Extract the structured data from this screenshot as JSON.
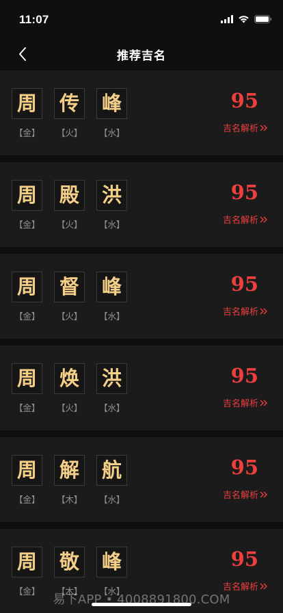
{
  "status_bar": {
    "time": "11:07"
  },
  "nav": {
    "title": "推荐吉名",
    "back_icon": "chevron-left-icon"
  },
  "colors": {
    "background": "#0f0f0f",
    "card": "#1b1b1b",
    "name_gold": "#f5cf87",
    "score_red": "#ee3f3f",
    "element_gray": "#8c8c8c"
  },
  "names": [
    {
      "chars": [
        {
          "char": "周",
          "element": "【金】"
        },
        {
          "char": "传",
          "element": "【火】"
        },
        {
          "char": "峰",
          "element": "【水】"
        }
      ],
      "score": "95",
      "link": "吉名解析"
    },
    {
      "chars": [
        {
          "char": "周",
          "element": "【金】"
        },
        {
          "char": "殿",
          "element": "【火】"
        },
        {
          "char": "洪",
          "element": "【水】"
        }
      ],
      "score": "95",
      "link": "吉名解析"
    },
    {
      "chars": [
        {
          "char": "周",
          "element": "【金】"
        },
        {
          "char": "督",
          "element": "【火】"
        },
        {
          "char": "峰",
          "element": "【水】"
        }
      ],
      "score": "95",
      "link": "吉名解析"
    },
    {
      "chars": [
        {
          "char": "周",
          "element": "【金】"
        },
        {
          "char": "焕",
          "element": "【火】"
        },
        {
          "char": "洪",
          "element": "【水】"
        }
      ],
      "score": "95",
      "link": "吉名解析"
    },
    {
      "chars": [
        {
          "char": "周",
          "element": "【金】"
        },
        {
          "char": "解",
          "element": "【木】"
        },
        {
          "char": "航",
          "element": "【水】"
        }
      ],
      "score": "95",
      "link": "吉名解析"
    },
    {
      "chars": [
        {
          "char": "周",
          "element": "【金】"
        },
        {
          "char": "敬",
          "element": "【木】"
        },
        {
          "char": "峰",
          "element": "【水】"
        }
      ],
      "score": "95",
      "link": "吉名解析"
    }
  ],
  "watermark": "易下APP • 4008891800.COM"
}
